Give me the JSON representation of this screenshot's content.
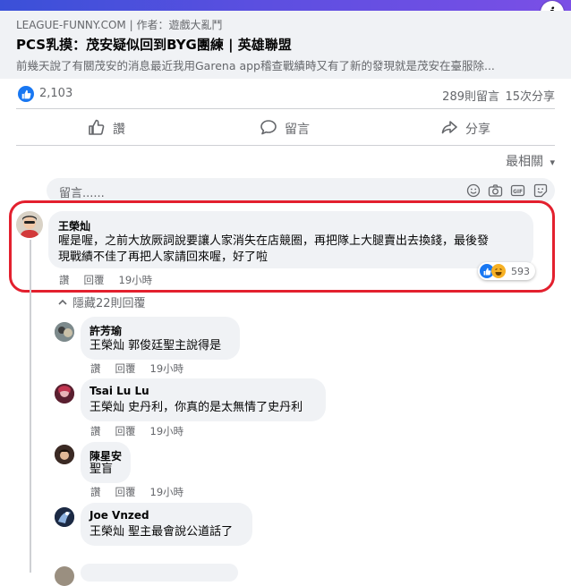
{
  "link_preview": {
    "source": "LEAGUE-FUNNY.COM | 作者：遊戲大亂鬥",
    "title": "PCS乳摸：茂安疑似回到BYG團練 | 英雄聯盟",
    "description": "前幾天說了有關茂安的消息最近我用Garena app稽查戰績時又有了新的發現就是茂安在臺服除..."
  },
  "stats": {
    "likes": "2,103",
    "comments": "289則留言",
    "shares": "15次分享"
  },
  "actions": {
    "like": "讚",
    "comment": "留言",
    "share": "分享"
  },
  "sort_label": "最相關",
  "composer_placeholder": "留言......",
  "main_comment": {
    "author": "王榮灿",
    "text_line1": "喔是喔，之前大放厥詞說要讓人家消失在店競圈，再把隊上大腿賣出去換錢，最後發",
    "text_line2": "現戰績不佳了再把人家請回來喔，好了啦",
    "like_label": "讚",
    "reply_label": "回覆",
    "time": "19小時",
    "reaction_count": "593"
  },
  "hide_replies_label": "隱藏22則回覆",
  "replies": [
    {
      "author": "許芳瑜",
      "tag": "王榮灿",
      "text": "郭俊廷聖主說得是",
      "like_label": "讚",
      "reply_label": "回覆",
      "time": "19小時"
    },
    {
      "author": "Tsai Lu Lu",
      "tag": "王榮灿",
      "text": "史丹利，你真的是太無情了史丹利",
      "like_label": "讚",
      "reply_label": "回覆",
      "time": "19小時"
    },
    {
      "author": "陳星安",
      "tag": "",
      "text": "聖盲",
      "like_label": "讚",
      "reply_label": "回覆",
      "time": "19小時"
    },
    {
      "author": "Joe Vnzed",
      "tag": "王榮灿",
      "text": "聖主最會說公道話了",
      "like_label": "讚",
      "reply_label": "回覆",
      "time": "19小時"
    }
  ],
  "colors": {
    "accent": "#1877f2",
    "highlight": "#e3202e",
    "bubble": "#f0f2f5",
    "muted": "#65676b"
  }
}
